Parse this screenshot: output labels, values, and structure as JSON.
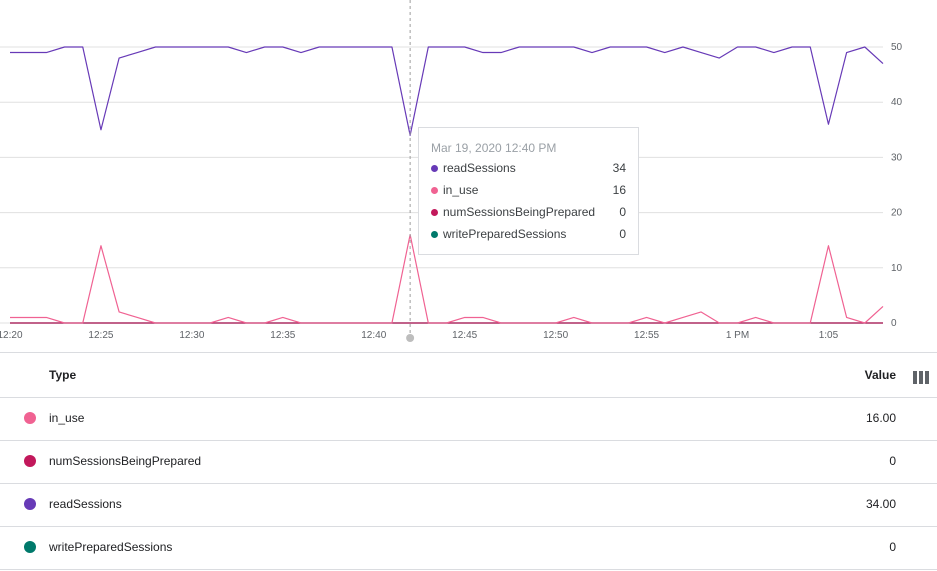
{
  "chart_data": {
    "type": "line",
    "x_labels": [
      "12:20",
      "12:25",
      "12:30",
      "12:35",
      "12:40",
      "12:45",
      "12:50",
      "12:55",
      "1 PM",
      "1:05"
    ],
    "x_minutes": [
      0,
      1,
      2,
      3,
      4,
      5,
      6,
      7,
      8,
      9,
      10,
      11,
      12,
      13,
      14,
      15,
      16,
      17,
      18,
      19,
      20,
      21,
      22,
      23,
      24,
      25,
      26,
      27,
      28,
      29,
      30,
      31,
      32,
      33,
      34,
      35,
      36,
      37,
      38,
      39,
      40,
      41,
      42,
      43,
      44,
      45,
      46,
      47,
      48
    ],
    "ylim": [
      0,
      50
    ],
    "y_ticks": [
      0,
      10,
      20,
      30,
      40,
      50
    ],
    "grid": true,
    "series": [
      {
        "name": "readSessions",
        "color": "#673ab7",
        "values": [
          49,
          49,
          49,
          50,
          50,
          35,
          48,
          49,
          50,
          50,
          50,
          50,
          50,
          49,
          50,
          50,
          49,
          50,
          50,
          50,
          50,
          50,
          34,
          50,
          50,
          50,
          49,
          49,
          50,
          50,
          50,
          50,
          49,
          50,
          50,
          50,
          49,
          50,
          49,
          48,
          50,
          50,
          49,
          50,
          50,
          36,
          49,
          50,
          47
        ]
      },
      {
        "name": "in_use",
        "color": "#f06292",
        "values": [
          1,
          1,
          1,
          0,
          0,
          14,
          2,
          1,
          0,
          0,
          0,
          0,
          1,
          0,
          0,
          1,
          0,
          0,
          0,
          0,
          0,
          0,
          16,
          0,
          0,
          1,
          1,
          0,
          0,
          0,
          0,
          1,
          0,
          0,
          0,
          1,
          0,
          1,
          2,
          0,
          0,
          1,
          0,
          0,
          0,
          14,
          1,
          0,
          3
        ]
      },
      {
        "name": "numSessionsBeingPrepared",
        "color": "#c2185b",
        "values": [
          0,
          0,
          0,
          0,
          0,
          0,
          0,
          0,
          0,
          0,
          0,
          0,
          0,
          0,
          0,
          0,
          0,
          0,
          0,
          0,
          0,
          0,
          0,
          0,
          0,
          0,
          0,
          0,
          0,
          0,
          0,
          0,
          0,
          0,
          0,
          0,
          0,
          0,
          0,
          0,
          0,
          0,
          0,
          0,
          0,
          0,
          0,
          0,
          0
        ]
      },
      {
        "name": "writePreparedSessions",
        "color": "#00796b",
        "values": [
          0,
          0,
          0,
          0,
          0,
          0,
          0,
          0,
          0,
          0,
          0,
          0,
          0,
          0,
          0,
          0,
          0,
          0,
          0,
          0,
          0,
          0,
          0,
          0,
          0,
          0,
          0,
          0,
          0,
          0,
          0,
          0,
          0,
          0,
          0,
          0,
          0,
          0,
          0,
          0,
          0,
          0,
          0,
          0,
          0,
          0,
          0,
          0,
          0
        ]
      }
    ],
    "cursor_minute": 22
  },
  "tooltip": {
    "title": "Mar 19, 2020 12:40 PM",
    "rows": [
      {
        "name": "readSessions",
        "value": "34",
        "color": "#673ab7"
      },
      {
        "name": "in_use",
        "value": "16",
        "color": "#f06292"
      },
      {
        "name": "numSessionsBeingPrepared",
        "value": "0",
        "color": "#c2185b"
      },
      {
        "name": "writePreparedSessions",
        "value": "0",
        "color": "#00796b"
      }
    ]
  },
  "table": {
    "header_type": "Type",
    "header_value": "Value",
    "columns_icon": "view-column-icon",
    "rows": [
      {
        "name": "in_use",
        "value": "16.00",
        "color": "#f06292"
      },
      {
        "name": "numSessionsBeingPrepared",
        "value": "0",
        "color": "#c2185b"
      },
      {
        "name": "readSessions",
        "value": "34.00",
        "color": "#673ab7"
      },
      {
        "name": "writePreparedSessions",
        "value": "0",
        "color": "#00796b"
      }
    ]
  }
}
